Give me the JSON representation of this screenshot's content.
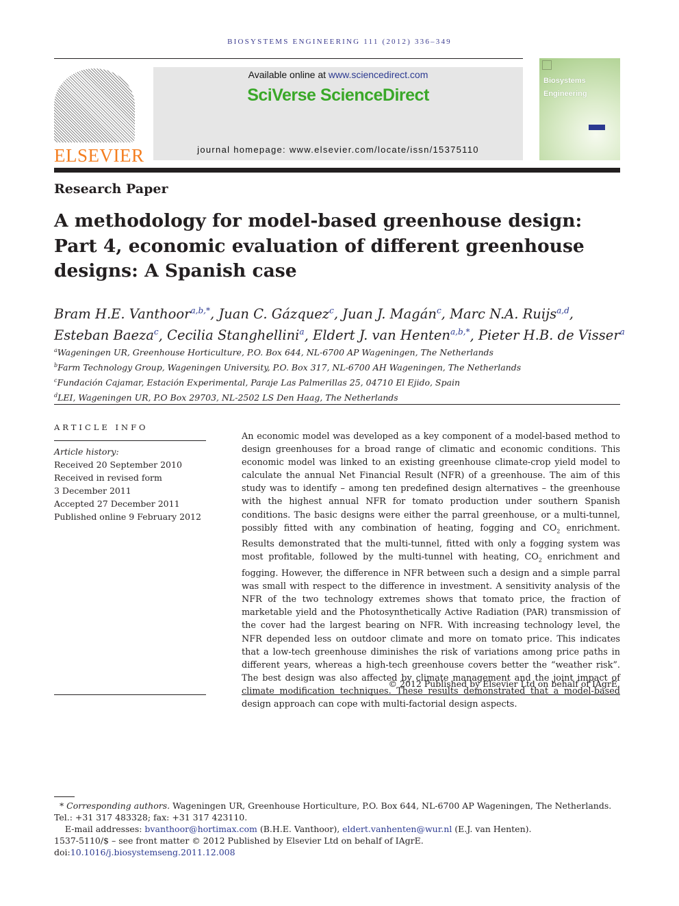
{
  "running_head": "BIOSYSTEMS ENGINEERING 111 (2012) 336–349",
  "publisher_logo": "ELSEVIER",
  "banner": {
    "available_prefix": "Available online at ",
    "available_link": "www.sciencedirect.com",
    "brand": "SciVerse ScienceDirect",
    "homepage": "journal homepage: www.elsevier.com/locate/issn/15375110",
    "brand_color": "#3aa829"
  },
  "cover": {
    "title_line1": "Biosystems",
    "title_line2": "Engineering"
  },
  "paper_type": "Research Paper",
  "title": "A methodology for model-based greenhouse design: Part 4, economic evaluation of different greenhouse designs: A Spanish case",
  "authors": [
    {
      "name": "Bram H.E. Vanthoor",
      "sup": "a,b,*"
    },
    {
      "name": "Juan C. Gázquez",
      "sup": "c"
    },
    {
      "name": "Juan J. Magán",
      "sup": "c"
    },
    {
      "name": "Marc N.A. Ruijs",
      "sup": "a,d"
    },
    {
      "name": "Esteban Baeza",
      "sup": "c"
    },
    {
      "name": "Cecilia Stanghellini",
      "sup": "a"
    },
    {
      "name": "Eldert J. van Henten",
      "sup": "a,b,*"
    },
    {
      "name": "Pieter H.B. de Visser",
      "sup": "a"
    }
  ],
  "affiliations": [
    {
      "key": "a",
      "text": "Wageningen UR, Greenhouse Horticulture, P.O. Box 644, NL-6700 AP Wageningen, The Netherlands"
    },
    {
      "key": "b",
      "text": "Farm Technology Group, Wageningen University, P.O. Box 317, NL-6700 AH Wageningen, The Netherlands"
    },
    {
      "key": "c",
      "text": "Fundación Cajamar, Estación Experimental, Paraje Las Palmerillas 25, 04710 El Ejido, Spain"
    },
    {
      "key": "d",
      "text": "LEI, Wageningen UR, P.O Box 29703, NL-2502 LS Den Haag, The Netherlands"
    }
  ],
  "article_info": {
    "heading": "ARTICLE INFO",
    "history_label": "Article history:",
    "history": [
      "Received 20 September 2010",
      "Received in revised form",
      "3 December 2011",
      "Accepted 27 December 2011",
      "Published online 9 February 2012"
    ]
  },
  "abstract": {
    "p1": "An economic model was developed as a key component of a model-based method to design greenhouses for a broad range of climatic and economic conditions. This economic model was linked to an existing greenhouse climate-crop yield model to calculate the annual Net Financial Result (NFR) of a greenhouse. The aim of this study was to identify – among ten predefined design alternatives – the greenhouse with the highest annual NFR for tomato production under southern Spanish conditions. The basic designs were either the parral greenhouse, or a multi-tunnel, possibly fitted with any combination of heating, fogging and CO",
    "sub1": "2",
    "p2": " enrichment. Results demonstrated that the multi-tunnel, fitted with only a fogging system was most profitable, followed by the multi-tunnel with heating, CO",
    "sub2": "2",
    "p3": " enrichment and fogging. However, the difference in NFR between such a design and a simple parral was small with respect to the difference in investment. A sensitivity analysis of the NFR of the two technology extremes shows that tomato price, the fraction of marketable yield and the Photosynthetically Active Radiation (PAR) transmission of the cover had the largest bearing on NFR. With increasing technology level, the NFR depended less on outdoor climate and more on tomato price. This indicates that a low-tech greenhouse diminishes the risk of variations among price paths in different years, whereas a high-tech greenhouse covers better the “weather risk”. The best design was also affected by climate management and the joint impact of climate modification techniques. These results demonstrated that a model-based design approach can cope with multi-factorial design aspects.",
    "copyright": "© 2012 Published by Elsevier Ltd on behalf of IAgrE."
  },
  "footnotes": {
    "corresponding": "* Corresponding authors.",
    "corresponding_text": " Wageningen UR, Greenhouse Horticulture, P.O. Box 644, NL-6700 AP Wageningen, The Netherlands. Tel.: +31 317 483328; fax: +31 317 423110.",
    "email_label": "E-mail addresses: ",
    "email1": "bvanthoor@hortimax.com",
    "email1_name": " (B.H.E. Vanthoor), ",
    "email2": "eldert.vanhenten@wur.nl",
    "email2_name": " (E.J. van Henten).",
    "issn": "1537-5110/$ – see front matter © 2012 Published by Elsevier Ltd on behalf of IAgrE.",
    "doi_label": "doi:",
    "doi": "10.1016/j.biosystemseng.2011.12.008"
  }
}
